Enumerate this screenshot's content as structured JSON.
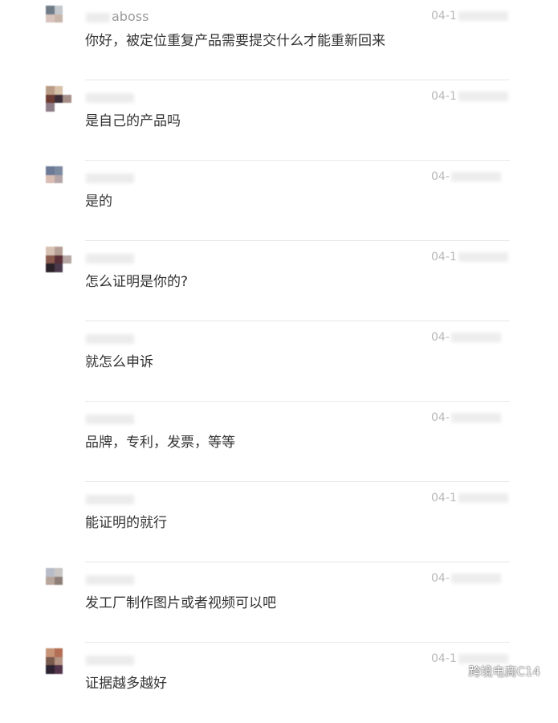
{
  "messages": [
    {
      "username_visible": "aboss",
      "time_visible": "04-1",
      "text": "你好，被定位重复产品需要提交什么才能重新回来",
      "avatar_colors": [
        "#6f7c88",
        "#c4c8cd",
        "#ffffff",
        "#d8c4bc",
        "#c8b6aa",
        "#ffffff",
        "#ffffff",
        "#ffffff",
        "#ffffff"
      ]
    },
    {
      "username_visible": "",
      "time_visible": "04-1",
      "text": "是自己的产品吗",
      "avatar_colors": [
        "#b99c85",
        "#d6c1a9",
        "#ffffff",
        "#6d3d35",
        "#3d2f3a",
        "#a58f88",
        "#8e7c86",
        "#ffffff",
        "#ffffff"
      ]
    },
    {
      "username_visible": "",
      "time_visible": "04-",
      "text": "是的",
      "avatar_colors": [
        "#6c7a98",
        "#7c8aa0",
        "#ffffff",
        "#d9bcb2",
        "#b4a6a8",
        "#ffffff",
        "#ffffff",
        "#ffffff",
        "#ffffff"
      ]
    },
    {
      "username_visible": "",
      "time_visible": "04-1",
      "text": "怎么证明是你的?",
      "avatar_colors": [
        "#d7c1b3",
        "#b59e93",
        "#ffffff",
        "#8a5a4e",
        "#5a2f38",
        "#b6a6a4",
        "#2a2128",
        "#4a3a4c",
        "#ffffff"
      ]
    },
    {
      "username_visible": "",
      "time_visible": "04-",
      "text": "就怎么申诉",
      "avatar_colors": []
    },
    {
      "username_visible": "",
      "time_visible": "04-",
      "text": "品牌，专利，发票，等等",
      "avatar_colors": []
    },
    {
      "username_visible": "",
      "time_visible": "04-1",
      "text": "能证明的就行",
      "avatar_colors": []
    },
    {
      "username_visible": "",
      "time_visible": "04-",
      "text": "发工厂制作图片或者视频可以吧",
      "avatar_colors": [
        "#b8bcc9",
        "#c9c6c4",
        "#ffffff",
        "#b7a49a",
        "#8d7f77",
        "#ffffff",
        "#ffffff",
        "#ffffff",
        "#ffffff"
      ]
    },
    {
      "username_visible": "",
      "time_visible": "04-1",
      "text": "证据越多越好",
      "avatar_colors": [
        "#c69377",
        "#b36e54",
        "#ffffff",
        "#7b5a4e",
        "#b69483",
        "#ffffff",
        "#2c2231",
        "#54344a",
        "#ffffff"
      ]
    }
  ],
  "watermark": {
    "icon": "wechat-icon",
    "text": "跨境电商C14"
  }
}
